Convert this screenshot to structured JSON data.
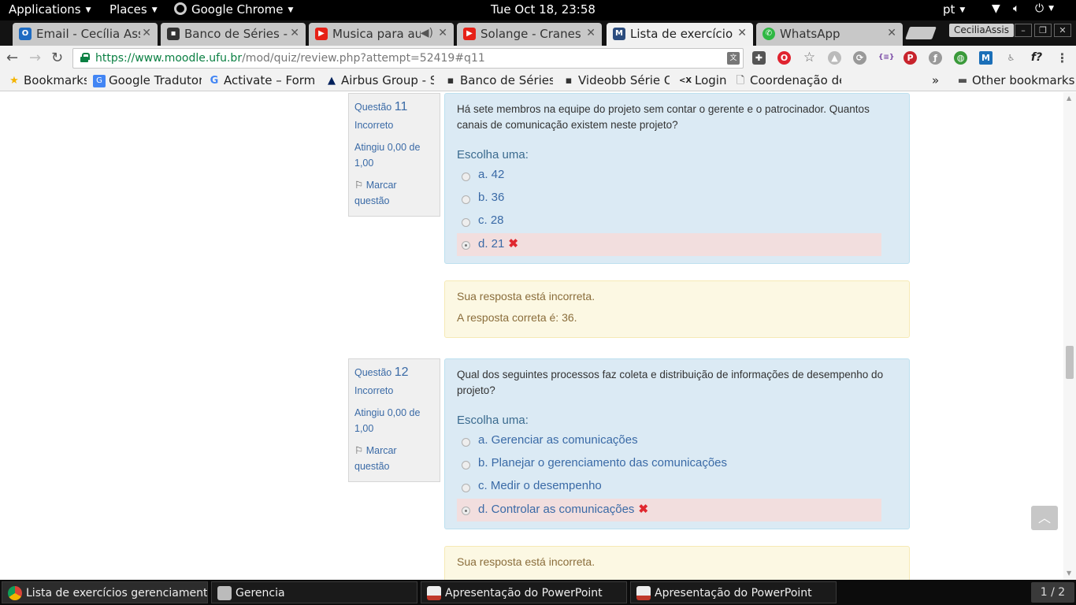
{
  "topbar": {
    "applications": "Applications",
    "places": "Places",
    "chrome": "Google Chrome",
    "clock": "Tue Oct 18, 23:58",
    "lang": "pt"
  },
  "tabs": [
    {
      "label": "Email - Cecília Assis",
      "icon": "outlook-icon",
      "color": "#1e6bc2"
    },
    {
      "label": "Banco de Séries - C",
      "icon": "film-icon",
      "color": "#333333"
    },
    {
      "label": "Musica para aum",
      "icon": "youtube-icon",
      "color": "#e62117"
    },
    {
      "label": "Solange - Cranes in",
      "icon": "youtube-icon",
      "color": "#e62117"
    },
    {
      "label": "Lista de exercícios",
      "icon": "moodle-icon",
      "color": "#2b4c7e"
    },
    {
      "label": "WhatsApp",
      "icon": "whatsapp-icon",
      "color": "#2fb843"
    }
  ],
  "profile": "CeciliaAssis",
  "url": {
    "scheme": "https://",
    "host": "www.moodle.ufu.br",
    "path": "/mod/quiz/review.php?attempt=52419#q11"
  },
  "bookmarks": [
    {
      "label": "Bookmarks",
      "icon": "star-icon"
    },
    {
      "label": "Google Tradutor",
      "icon": "translate-icon"
    },
    {
      "label": "Activate – Format",
      "icon": "google-icon"
    },
    {
      "label": "Airbus Group - St",
      "icon": "airbus-icon"
    },
    {
      "label": "Banco de Séries -",
      "icon": "film-icon"
    },
    {
      "label": "Videobb Série On",
      "icon": "film-icon"
    },
    {
      "label": "Login",
      "icon": "login-icon"
    },
    {
      "label": "Coordenação de",
      "icon": "page-icon"
    }
  ],
  "bookmarks_more": "»",
  "other_bookmarks": "Other bookmarks",
  "questions": [
    {
      "label": "Questão",
      "number": "11",
      "status": "Incorreto",
      "grade": "Atingiu 0,00 de 1,00",
      "flag": "Marcar questão",
      "text": "Há sete membros na equipe do projeto sem contar o gerente e o patrocinador. Quantos canais de comunicação existem neste projeto?",
      "prompt": "Escolha uma:",
      "answers": [
        "a. 42",
        "b. 36",
        "c. 28",
        "d. 21"
      ],
      "selected": 3,
      "feedback": [
        "Sua resposta está incorreta.",
        "A resposta correta é: 36."
      ]
    },
    {
      "label": "Questão",
      "number": "12",
      "status": "Incorreto",
      "grade": "Atingiu 0,00 de 1,00",
      "flag": "Marcar questão",
      "text": "Qual dos seguintes processos faz coleta e distribuição de informações de desempenho do projeto?",
      "prompt": "Escolha uma:",
      "answers": [
        "a. Gerenciar as comunicações",
        "b. Planejar o gerenciamento das comunicações",
        "c. Medir o desempenho",
        "d. Controlar as comunicações"
      ],
      "selected": 3,
      "feedback": [
        "Sua resposta está incorreta."
      ]
    }
  ],
  "taskbar": [
    {
      "label": "Lista de exercícios gerenciamento ...",
      "icon": "chrome-icon"
    },
    {
      "label": "Gerencia",
      "icon": "folder-icon"
    },
    {
      "label": "Apresentação do PowerPoint",
      "icon": "presentation-icon"
    },
    {
      "label": "Apresentação do PowerPoint",
      "icon": "presentation-icon"
    }
  ],
  "workspace": "1 / 2",
  "colors": {
    "question_bg": "#dbeaf4",
    "incorrect_bg": "#f2dede",
    "feedback_bg": "#fcf8e3",
    "link": "#3a6aa6",
    "url_host": "#0b8043"
  }
}
